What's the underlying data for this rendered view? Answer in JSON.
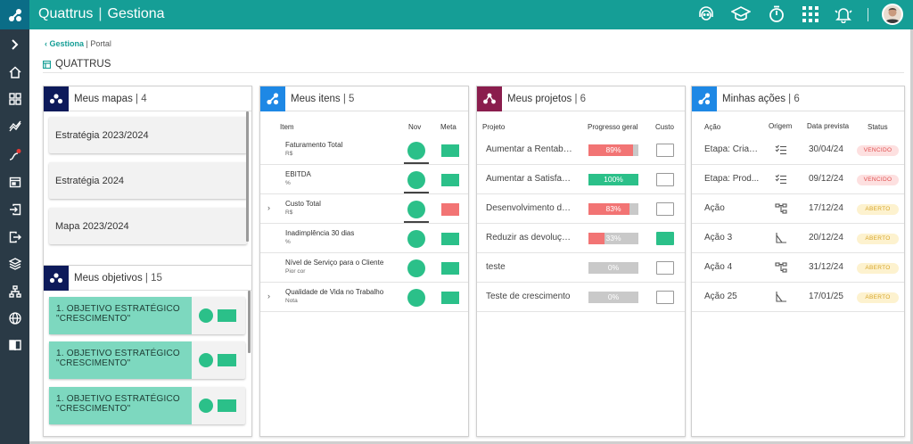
{
  "app": {
    "brand": "Quattrus",
    "module": "Gestiona"
  },
  "topbar_icons": [
    "support-icon",
    "graduation-cap-icon",
    "stopwatch-icon",
    "apps-grid-icon",
    "bell-icon"
  ],
  "sidebar_icons": [
    "expand-chevron-icon",
    "home-icon",
    "dashboard-icon",
    "trend-icon",
    "routes-icon",
    "calendar-icon",
    "login-icon",
    "export-icon",
    "layers-icon",
    "hierarchy-icon",
    "globe-icon",
    "book-icon"
  ],
  "breadcrumb": {
    "parent": "Gestiona",
    "current": "Portal"
  },
  "page_title": "QUATTRUS",
  "maps": {
    "title": "Meus mapas",
    "count": "4",
    "items": [
      "Estratégia 2023/2024",
      "Estratégia 2024",
      "Mapa 2023/2024"
    ]
  },
  "objectives": {
    "title": "Meus objetivos",
    "count": "15",
    "items": [
      {
        "line1": "1. OBJETIVO ESTRATÉGICO",
        "line2": "\"CRESCIMENTO\""
      },
      {
        "line1": "1. OBJETIVO ESTRATÉGICO",
        "line2": "\"CRESCIMENTO\""
      },
      {
        "line1": "1. OBJETIVO ESTRATÉGICO",
        "line2": "\"CRESCIMENTO\""
      }
    ]
  },
  "items": {
    "title": "Meus itens",
    "count": "5",
    "columns": {
      "item": "Item",
      "nov": "Nov",
      "meta": "Meta"
    },
    "rows": [
      {
        "name": "Faturamento Total",
        "unit": "R$",
        "expandable": false,
        "nov_color": "#2bc089",
        "meta_color": "#2bc089",
        "underline": true
      },
      {
        "name": "EBITDA",
        "unit": "%",
        "expandable": false,
        "nov_color": "#2bc089",
        "meta_color": "#2bc089",
        "underline": true
      },
      {
        "name": "Custo Total",
        "unit": "R$",
        "expandable": true,
        "nov_color": "#2bc089",
        "meta_color": "#f27474",
        "underline": true
      },
      {
        "name": "Inadimplência 30 dias",
        "unit": "%",
        "expandable": false,
        "nov_color": "#2bc089",
        "meta_color": "#2bc089",
        "underline": false
      },
      {
        "name": "Nível de Serviço para o Cliente",
        "unit": "Pior cor",
        "expandable": false,
        "nov_color": "#2bc089",
        "meta_color": "#2bc089",
        "underline": false
      },
      {
        "name": "Qualidade de Vida no Trabalho",
        "unit": "Nota",
        "expandable": true,
        "nov_color": "#2bc089",
        "meta_color": "#2bc089",
        "underline": false
      }
    ]
  },
  "projects": {
    "title": "Meus projetos",
    "count": "6",
    "columns": {
      "project": "Projeto",
      "progress": "Progresso geral",
      "cost": "Custo"
    },
    "rows": [
      {
        "name": "Aumentar a Rentabil...",
        "progress": 89,
        "label": "89%",
        "color": "#f27474",
        "cost_color": ""
      },
      {
        "name": "Aumentar a Satisfaç...",
        "progress": 100,
        "label": "100%",
        "color": "#2bc089",
        "cost_color": ""
      },
      {
        "name": "Desenvolvimento de...",
        "progress": 83,
        "label": "83%",
        "color": "#f27474",
        "cost_color": ""
      },
      {
        "name": "Reduzir as devoluçõ...",
        "progress": 33,
        "label": "33%",
        "color": "#f27474",
        "cost_color": "#2bc089"
      },
      {
        "name": "teste",
        "progress": 0,
        "label": "0%",
        "color": "#f27474",
        "cost_color": ""
      },
      {
        "name": "Teste de crescimento",
        "progress": 0,
        "label": "0%",
        "color": "#f27474",
        "cost_color": ""
      }
    ]
  },
  "actions": {
    "title": "Minhas ações",
    "count": "6",
    "columns": {
      "action": "Ação",
      "origin": "Origem",
      "date": "Data prevista",
      "status": "Status"
    },
    "rows": [
      {
        "name": "Etapa: Criaç...",
        "origin_icon": "checklist-icon",
        "date": "30/04/24",
        "status": "VENCIDO",
        "status_class": "st-red"
      },
      {
        "name": "Etapa: Prod...",
        "origin_icon": "checklist-icon",
        "date": "09/12/24",
        "status": "VENCIDO",
        "status_class": "st-red"
      },
      {
        "name": "Ação",
        "origin_icon": "hierarchy-icon",
        "date": "17/12/24",
        "status": "ABERTO",
        "status_class": "st-yellow"
      },
      {
        "name": "Ação 3",
        "origin_icon": "chart-icon",
        "date": "20/12/24",
        "status": "ABERTO",
        "status_class": "st-yellow"
      },
      {
        "name": "Ação 4",
        "origin_icon": "hierarchy-icon",
        "date": "31/12/24",
        "status": "ABERTO",
        "status_class": "st-yellow"
      },
      {
        "name": "Ação 25",
        "origin_icon": "chart-icon",
        "date": "17/01/25",
        "status": "ABERTO",
        "status_class": "st-yellow"
      }
    ]
  },
  "colors": {
    "primary": "#159e96",
    "sidebar": "#2a3a46",
    "maps_badge": "#0d1a5a",
    "items_badge": "#1e88e5",
    "projects_badge": "#8a1d4d",
    "actions_badge": "#1e88e5"
  }
}
